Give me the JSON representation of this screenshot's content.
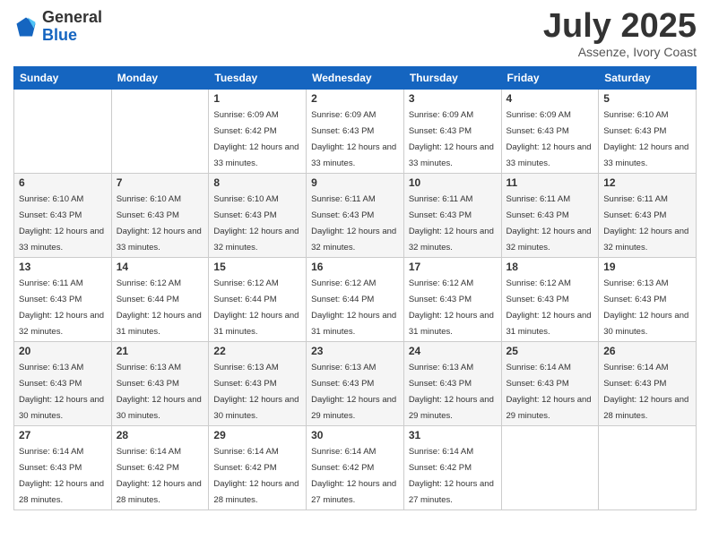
{
  "logo": {
    "general": "General",
    "blue": "Blue"
  },
  "header": {
    "month": "July 2025",
    "location": "Assenze, Ivory Coast"
  },
  "days_of_week": [
    "Sunday",
    "Monday",
    "Tuesday",
    "Wednesday",
    "Thursday",
    "Friday",
    "Saturday"
  ],
  "weeks": [
    [
      {
        "day": "",
        "sunrise": "",
        "sunset": "",
        "daylight": ""
      },
      {
        "day": "",
        "sunrise": "",
        "sunset": "",
        "daylight": ""
      },
      {
        "day": "1",
        "sunrise": "Sunrise: 6:09 AM",
        "sunset": "Sunset: 6:42 PM",
        "daylight": "Daylight: 12 hours and 33 minutes."
      },
      {
        "day": "2",
        "sunrise": "Sunrise: 6:09 AM",
        "sunset": "Sunset: 6:43 PM",
        "daylight": "Daylight: 12 hours and 33 minutes."
      },
      {
        "day": "3",
        "sunrise": "Sunrise: 6:09 AM",
        "sunset": "Sunset: 6:43 PM",
        "daylight": "Daylight: 12 hours and 33 minutes."
      },
      {
        "day": "4",
        "sunrise": "Sunrise: 6:09 AM",
        "sunset": "Sunset: 6:43 PM",
        "daylight": "Daylight: 12 hours and 33 minutes."
      },
      {
        "day": "5",
        "sunrise": "Sunrise: 6:10 AM",
        "sunset": "Sunset: 6:43 PM",
        "daylight": "Daylight: 12 hours and 33 minutes."
      }
    ],
    [
      {
        "day": "6",
        "sunrise": "Sunrise: 6:10 AM",
        "sunset": "Sunset: 6:43 PM",
        "daylight": "Daylight: 12 hours and 33 minutes."
      },
      {
        "day": "7",
        "sunrise": "Sunrise: 6:10 AM",
        "sunset": "Sunset: 6:43 PM",
        "daylight": "Daylight: 12 hours and 33 minutes."
      },
      {
        "day": "8",
        "sunrise": "Sunrise: 6:10 AM",
        "sunset": "Sunset: 6:43 PM",
        "daylight": "Daylight: 12 hours and 32 minutes."
      },
      {
        "day": "9",
        "sunrise": "Sunrise: 6:11 AM",
        "sunset": "Sunset: 6:43 PM",
        "daylight": "Daylight: 12 hours and 32 minutes."
      },
      {
        "day": "10",
        "sunrise": "Sunrise: 6:11 AM",
        "sunset": "Sunset: 6:43 PM",
        "daylight": "Daylight: 12 hours and 32 minutes."
      },
      {
        "day": "11",
        "sunrise": "Sunrise: 6:11 AM",
        "sunset": "Sunset: 6:43 PM",
        "daylight": "Daylight: 12 hours and 32 minutes."
      },
      {
        "day": "12",
        "sunrise": "Sunrise: 6:11 AM",
        "sunset": "Sunset: 6:43 PM",
        "daylight": "Daylight: 12 hours and 32 minutes."
      }
    ],
    [
      {
        "day": "13",
        "sunrise": "Sunrise: 6:11 AM",
        "sunset": "Sunset: 6:43 PM",
        "daylight": "Daylight: 12 hours and 32 minutes."
      },
      {
        "day": "14",
        "sunrise": "Sunrise: 6:12 AM",
        "sunset": "Sunset: 6:44 PM",
        "daylight": "Daylight: 12 hours and 31 minutes."
      },
      {
        "day": "15",
        "sunrise": "Sunrise: 6:12 AM",
        "sunset": "Sunset: 6:44 PM",
        "daylight": "Daylight: 12 hours and 31 minutes."
      },
      {
        "day": "16",
        "sunrise": "Sunrise: 6:12 AM",
        "sunset": "Sunset: 6:44 PM",
        "daylight": "Daylight: 12 hours and 31 minutes."
      },
      {
        "day": "17",
        "sunrise": "Sunrise: 6:12 AM",
        "sunset": "Sunset: 6:43 PM",
        "daylight": "Daylight: 12 hours and 31 minutes."
      },
      {
        "day": "18",
        "sunrise": "Sunrise: 6:12 AM",
        "sunset": "Sunset: 6:43 PM",
        "daylight": "Daylight: 12 hours and 31 minutes."
      },
      {
        "day": "19",
        "sunrise": "Sunrise: 6:13 AM",
        "sunset": "Sunset: 6:43 PM",
        "daylight": "Daylight: 12 hours and 30 minutes."
      }
    ],
    [
      {
        "day": "20",
        "sunrise": "Sunrise: 6:13 AM",
        "sunset": "Sunset: 6:43 PM",
        "daylight": "Daylight: 12 hours and 30 minutes."
      },
      {
        "day": "21",
        "sunrise": "Sunrise: 6:13 AM",
        "sunset": "Sunset: 6:43 PM",
        "daylight": "Daylight: 12 hours and 30 minutes."
      },
      {
        "day": "22",
        "sunrise": "Sunrise: 6:13 AM",
        "sunset": "Sunset: 6:43 PM",
        "daylight": "Daylight: 12 hours and 30 minutes."
      },
      {
        "day": "23",
        "sunrise": "Sunrise: 6:13 AM",
        "sunset": "Sunset: 6:43 PM",
        "daylight": "Daylight: 12 hours and 29 minutes."
      },
      {
        "day": "24",
        "sunrise": "Sunrise: 6:13 AM",
        "sunset": "Sunset: 6:43 PM",
        "daylight": "Daylight: 12 hours and 29 minutes."
      },
      {
        "day": "25",
        "sunrise": "Sunrise: 6:14 AM",
        "sunset": "Sunset: 6:43 PM",
        "daylight": "Daylight: 12 hours and 29 minutes."
      },
      {
        "day": "26",
        "sunrise": "Sunrise: 6:14 AM",
        "sunset": "Sunset: 6:43 PM",
        "daylight": "Daylight: 12 hours and 28 minutes."
      }
    ],
    [
      {
        "day": "27",
        "sunrise": "Sunrise: 6:14 AM",
        "sunset": "Sunset: 6:43 PM",
        "daylight": "Daylight: 12 hours and 28 minutes."
      },
      {
        "day": "28",
        "sunrise": "Sunrise: 6:14 AM",
        "sunset": "Sunset: 6:42 PM",
        "daylight": "Daylight: 12 hours and 28 minutes."
      },
      {
        "day": "29",
        "sunrise": "Sunrise: 6:14 AM",
        "sunset": "Sunset: 6:42 PM",
        "daylight": "Daylight: 12 hours and 28 minutes."
      },
      {
        "day": "30",
        "sunrise": "Sunrise: 6:14 AM",
        "sunset": "Sunset: 6:42 PM",
        "daylight": "Daylight: 12 hours and 27 minutes."
      },
      {
        "day": "31",
        "sunrise": "Sunrise: 6:14 AM",
        "sunset": "Sunset: 6:42 PM",
        "daylight": "Daylight: 12 hours and 27 minutes."
      },
      {
        "day": "",
        "sunrise": "",
        "sunset": "",
        "daylight": ""
      },
      {
        "day": "",
        "sunrise": "",
        "sunset": "",
        "daylight": ""
      }
    ]
  ]
}
